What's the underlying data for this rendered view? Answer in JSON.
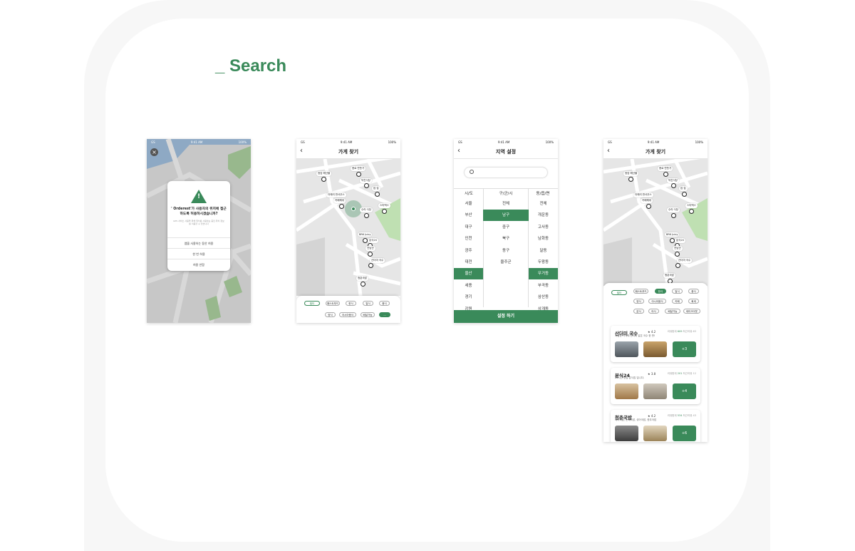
{
  "section_title": "_ Search",
  "colors": {
    "accent": "#3a8a5a",
    "map_bg": "#e6e6e6",
    "park": "#bfe0b2"
  },
  "status": {
    "carrier": "GS",
    "time": "9:41 AM",
    "battery": "100%"
  },
  "permission": {
    "title": "' Orderest'가 사용자의 위치에 접근하도록 허용하시겠습니까?",
    "message": "GPS 서비스 사용을 위해 위치를 사용하는 중인 위치 정보를 이용할 수 있습니다",
    "buttons": [
      "앱을 사용하는 동안 허용",
      "한 번 허용",
      "허용 안함"
    ]
  },
  "store_search": {
    "title": "가게 찾기",
    "places": [
      "정암 해산물",
      "종로 만둣가",
      "덕진식당",
      "밥 집",
      "더에리 판서우스",
      "카페해새",
      "스타벅스",
      "수라 식당",
      "BRK Juicy",
      "분식24",
      "전남관",
      "산더미 국수",
      "청춘국밥"
    ],
    "filter_chip": "필터",
    "chips": [
      "패스트푸드",
      "한식",
      "일식",
      "중식",
      "양식",
      "아시아음식",
      "배달가능",
      "..."
    ]
  },
  "region": {
    "title": "지역 설정",
    "search_placeholder": "",
    "headers": [
      "시/도",
      "구/군/시",
      "동/읍/면"
    ],
    "sido": [
      "서울",
      "부산",
      "대구",
      "인천",
      "광주",
      "대전",
      "울산",
      "세종",
      "경기",
      "강원"
    ],
    "gugun": [
      "전체",
      "남구",
      "중구",
      "북구",
      "동구",
      "울주군"
    ],
    "dong": [
      "전체",
      "개운동",
      "고사동",
      "남화동",
      "달동",
      "두왕동",
      "무거동",
      "부곡동",
      "삼산동",
      "상개동"
    ],
    "confirm": "설정 하기"
  },
  "results": {
    "title": "가게 찾기",
    "filter_chip": "필터",
    "chips": [
      "패스트푸드",
      "한식",
      "일식",
      "중식",
      "양식",
      "아시아음식",
      "카페",
      "회세",
      "분식",
      "야식",
      "배달가능",
      "테이크아웃"
    ],
    "cards": [
      {
        "name": "산더미 국수",
        "rating": "★ 4.2",
        "meta_label": "리뷰합계",
        "meta_count": "609",
        "meta2": "최근리뷰 63",
        "desc": "저렴한 가격에 산더미 같은 국수 한 판!",
        "more": "+3"
      },
      {
        "name": "분식24",
        "rating": "★ 3.8",
        "meta_label": "리뷰합계",
        "meta_count": "201",
        "meta2": "최근리뷰 12",
        "desc": "24시간 영업 분식집 입니다.",
        "more": "+4"
      },
      {
        "name": "청춘국밥",
        "rating": "★ 4.2",
        "meta_label": "리뷰합계",
        "meta_count": "534",
        "meta2": "최근리뷰 43",
        "desc": "돼지국밥, 순대국밥, 섞어국밥, 한우국밥",
        "more": "+6"
      }
    ]
  }
}
